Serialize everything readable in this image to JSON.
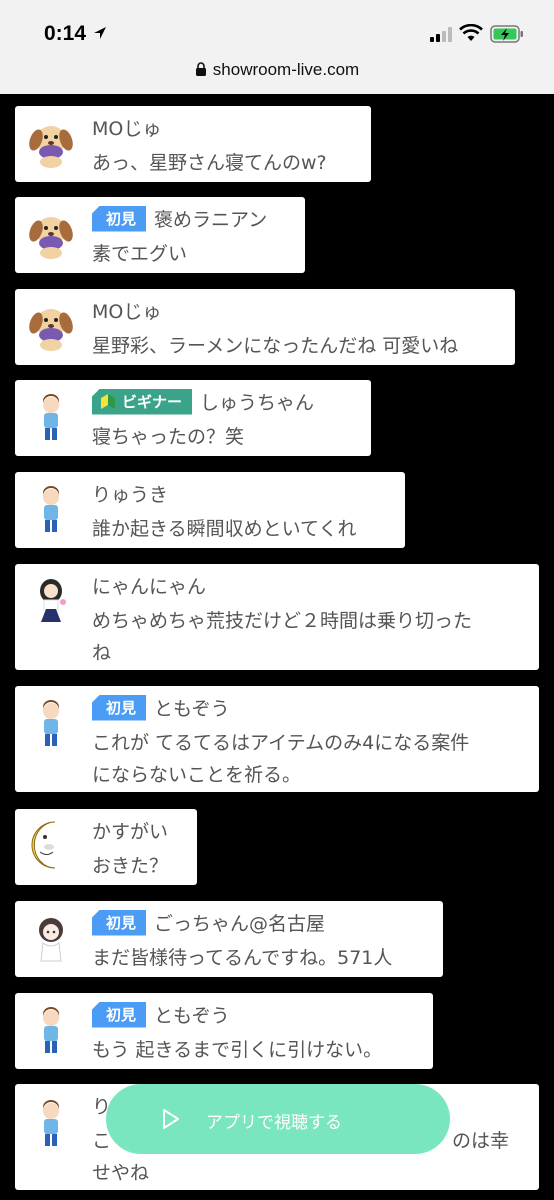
{
  "status_bar": {
    "time": "0:14"
  },
  "browser": {
    "url": "showroom-live.com"
  },
  "comments": [
    {
      "avatar": "dog-avatar",
      "badge": "",
      "name": "MOじゅ",
      "text": "あっ、星野さん寝てんのw?"
    },
    {
      "avatar": "dog-avatar",
      "badge": "初見",
      "name": "褒めラニアン",
      "text": "素でエグい"
    },
    {
      "avatar": "dog-avatar",
      "badge": "",
      "name": "MOじゅ",
      "text": "星野彩、ラーメンになったんだね 可愛いね"
    },
    {
      "avatar": "boy-avatar",
      "badge": "ビギナー",
      "name": "しゅうちゃん",
      "text": "寝ちゃったの？笑"
    },
    {
      "avatar": "boy-avatar",
      "badge": "",
      "name": "りゅうき",
      "text": "誰か起きる瞬間収めといてくれ"
    },
    {
      "avatar": "girl-avatar",
      "badge": "",
      "name": "にゃんにゃん",
      "text_line1": "めちゃめちゃ荒技だけど２時間は乗り切った",
      "text_line2": "ね"
    },
    {
      "avatar": "boy-avatar",
      "badge": "初見",
      "name": "ともぞう",
      "text_line1": "これが てるてるはアイテムのみ4になる案件",
      "text_line2": "にならないことを祈る。"
    },
    {
      "avatar": "moon-avatar",
      "badge": "",
      "name": "かすがい",
      "text": "おきた？"
    },
    {
      "avatar": "anime-avatar",
      "badge": "初見",
      "name": "ごっちゃん@名古屋",
      "text": "まだ皆様待ってるんですね。571人"
    },
    {
      "avatar": "boy-avatar",
      "badge": "初見",
      "name": "ともぞう",
      "text": "もう 起きるまで引くに引けない。"
    },
    {
      "avatar": "boy-avatar",
      "badge": "",
      "name": "り",
      "text_line1": "こ",
      "text_line1_end": "のは幸",
      "text_line2": "せやね"
    }
  ],
  "app_button": {
    "label": "アプリで視聴する"
  },
  "colors": {
    "first_time_badge": "#4b9cf4",
    "beginner_badge": "#3aa38a",
    "app_button": "#6fe4b8"
  }
}
